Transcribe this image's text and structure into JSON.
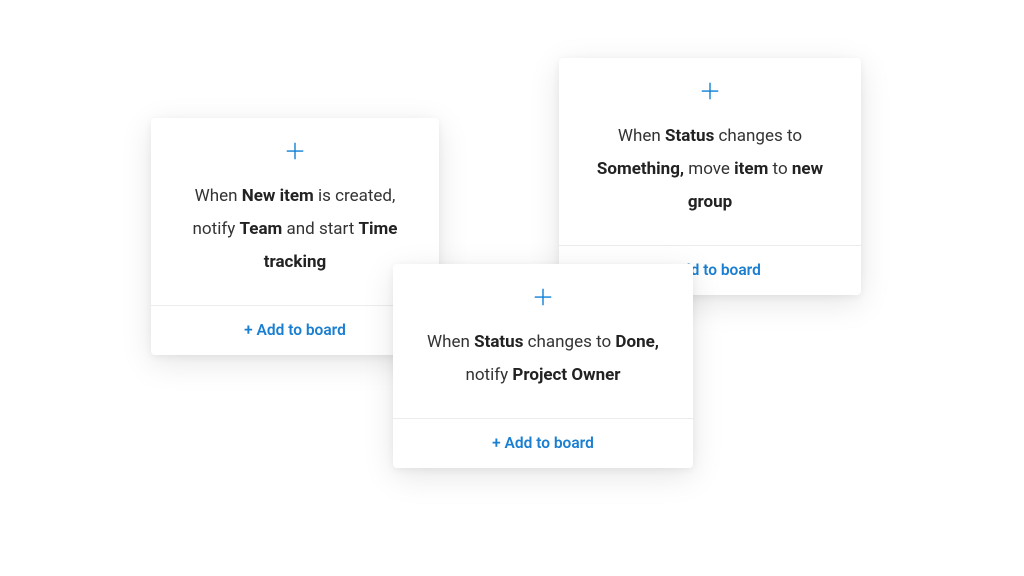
{
  "add_label": "+ Add to board",
  "cards": [
    {
      "segments": [
        {
          "t": "When ",
          "b": false
        },
        {
          "t": "New item",
          "b": true
        },
        {
          "t": " is created, notify ",
          "b": false
        },
        {
          "t": "Team",
          "b": true
        },
        {
          "t": " and start ",
          "b": false
        },
        {
          "t": "Time tracking",
          "b": true
        }
      ]
    },
    {
      "segments": [
        {
          "t": "When ",
          "b": false
        },
        {
          "t": "Status",
          "b": true
        },
        {
          "t": " changes to ",
          "b": false
        },
        {
          "t": "Something,",
          "b": true
        },
        {
          "t": " move ",
          "b": false
        },
        {
          "t": "item",
          "b": true
        },
        {
          "t": " to ",
          "b": false
        },
        {
          "t": "new group",
          "b": true
        }
      ]
    },
    {
      "segments": [
        {
          "t": "When ",
          "b": false
        },
        {
          "t": "Status",
          "b": true
        },
        {
          "t": " changes to ",
          "b": false
        },
        {
          "t": "Done,",
          "b": true
        },
        {
          "t": " notify ",
          "b": false
        },
        {
          "t": "Project Owner",
          "b": true
        }
      ]
    }
  ]
}
